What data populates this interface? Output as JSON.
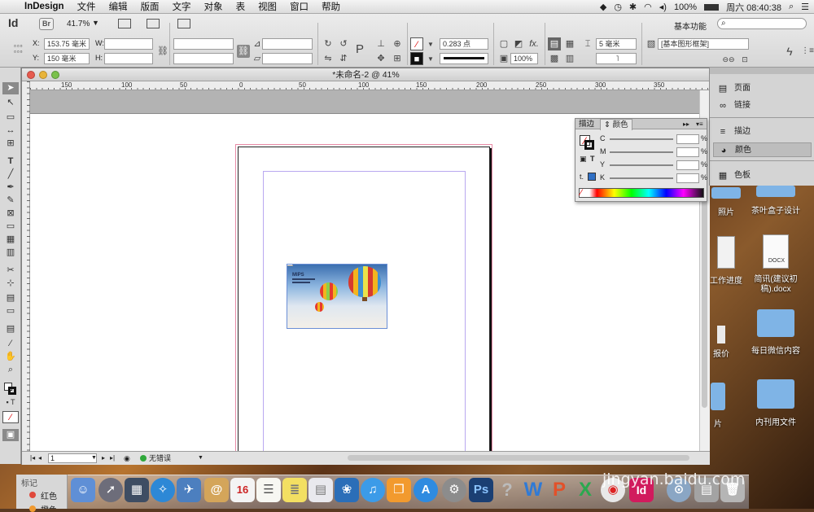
{
  "menubar": {
    "app_name": "InDesign",
    "items": [
      "文件",
      "编辑",
      "版面",
      "文字",
      "对象",
      "表",
      "视图",
      "窗口",
      "帮助"
    ],
    "battery": "100%",
    "clock": "周六 08:40:38"
  },
  "app_bar": {
    "logo": "Id",
    "bridge": "Br",
    "zoom": "41.7%",
    "workspace": "基本功能"
  },
  "control": {
    "x_label": "X:",
    "x_value": "153.75 毫米",
    "y_label": "Y:",
    "y_value": "150 毫米",
    "w_label": "W:",
    "h_label": "H:",
    "stroke_weight": "0.283 点",
    "opacity": "100%",
    "gap": "5 毫米",
    "frame_style": "[基本图形框架]"
  },
  "document": {
    "title": "*未命名-2 @ 41%",
    "ruler_ticks": [
      "150",
      "100",
      "50",
      "0",
      "50",
      "100",
      "150",
      "200",
      "250",
      "300",
      "350"
    ],
    "page_number": "1",
    "preflight": "无错误"
  },
  "right_panels": {
    "items": [
      {
        "label": "页面",
        "icon": "pages-icon"
      },
      {
        "label": "链接",
        "icon": "links-icon"
      },
      {
        "label": "描边",
        "icon": "stroke-icon"
      },
      {
        "label": "颜色",
        "icon": "color-icon"
      },
      {
        "label": "色板",
        "icon": "swatches-icon"
      }
    ]
  },
  "color_panel": {
    "tab_stroke": "描边",
    "tab_color": "颜色",
    "channels": [
      "C",
      "M",
      "Y",
      "K"
    ],
    "unit": "%"
  },
  "placed_image": {
    "caption_title": "MIPS"
  },
  "desktop": {
    "files": [
      {
        "label": "照片",
        "kind": "folder"
      },
      {
        "label": "茶叶盒子设计",
        "kind": "folder"
      },
      {
        "label": "工作进度",
        "kind": "doc"
      },
      {
        "label": "简讯(建议初稿).docx",
        "kind": "docx",
        "badge": "DOCX"
      },
      {
        "label": "报价",
        "kind": "doc"
      },
      {
        "label": "每日微信内容",
        "kind": "folder"
      },
      {
        "label": "片",
        "kind": "folder"
      },
      {
        "label": "内刊用文件",
        "kind": "folder"
      }
    ],
    "watermark": "jingyan.baidu.com"
  },
  "labels_panel": {
    "title": "标记",
    "items": [
      "红色",
      "橙色"
    ]
  },
  "colors": {
    "accent_pink": "#d94a7a",
    "indesign_pink": "#d11b5d"
  }
}
